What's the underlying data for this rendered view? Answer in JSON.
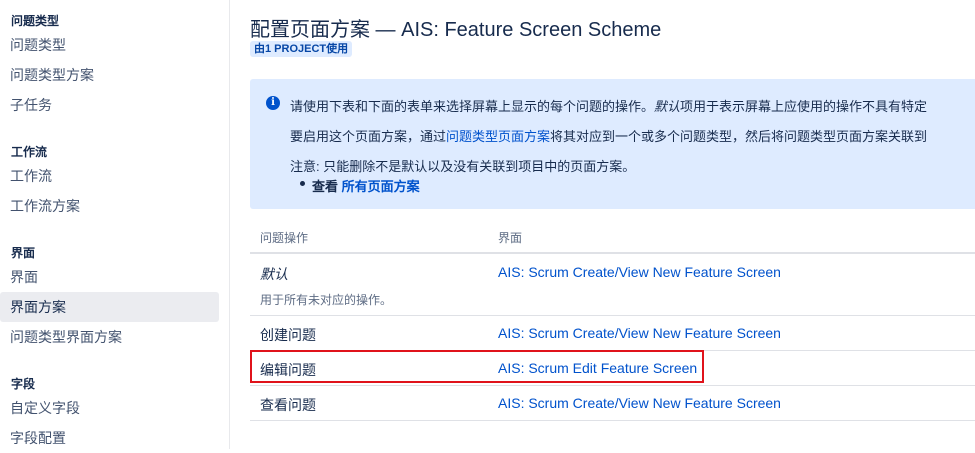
{
  "sidebar": {
    "sections": [
      {
        "heading": "问题类型",
        "items": [
          "问题类型",
          "问题类型方案",
          "子任务"
        ]
      },
      {
        "heading": "工作流",
        "items": [
          "工作流",
          "工作流方案"
        ]
      },
      {
        "heading": "界面",
        "items": [
          "界面",
          "界面方案",
          "问题类型界面方案"
        ]
      },
      {
        "heading": "字段",
        "items": [
          "自定义字段",
          "字段配置"
        ]
      }
    ],
    "active_item": "界面方案"
  },
  "header": {
    "title": "配置页面方案 — AIS: Feature Screen Scheme",
    "badge": "由1 PROJECT使用"
  },
  "info": {
    "line1_prefix": "请使用下表和下面的表单来选择屏幕上显示的每个问题的操作。",
    "line1_italic": "默认",
    "line1_suffix": "项用于表示屏幕上应使用的操作不具有特定",
    "line2_prefix": "要启用这个页面方案，通过",
    "line2_link": "问题类型页面方案",
    "line2_suffix": "将其对应到一个或多个问题类型，然后将问题类型页面方案关联到",
    "line3": "注意: 只能删除不是默认以及没有关联到项目中的页面方案。",
    "bullet_prefix": "查看",
    "bullet_link": "所有页面方案"
  },
  "table": {
    "headers": {
      "operation": "问题操作",
      "screen": "界面"
    },
    "rows": [
      {
        "operation": "默认",
        "note": "用于所有未对应的操作。",
        "screen": "AIS: Scrum Create/View New Feature Screen"
      },
      {
        "operation": "创建问题",
        "screen": "AIS: Scrum Create/View New Feature Screen"
      },
      {
        "operation": "编辑问题",
        "screen": "AIS: Scrum Edit Feature Screen"
      },
      {
        "operation": "查看问题",
        "screen": "AIS: Scrum Create/View New Feature Screen"
      }
    ]
  },
  "colors": {
    "link": "#0052cc",
    "info_background": "#deebff",
    "highlight_border": "#e0131b",
    "active_nav_background": "#ebecf0"
  }
}
